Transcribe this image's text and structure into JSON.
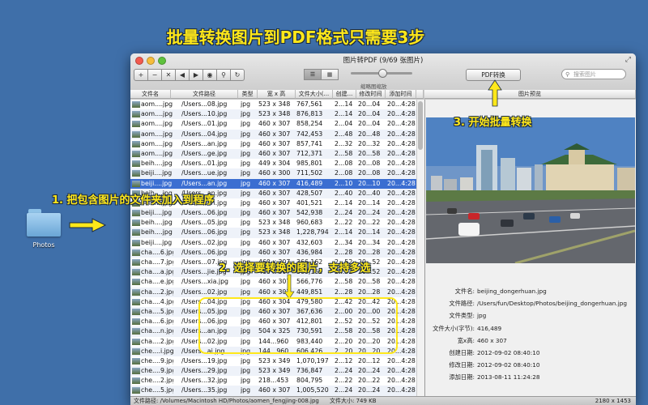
{
  "headline": "批量转换图片到PDF格式只需要3步",
  "desktop": {
    "folder_label": "Photos"
  },
  "callouts": {
    "step1": "1. 把包含图片的文件夹加入到程序",
    "step2": "2. 选择要转换的图片，支持多选",
    "step3": "3. 开始批量转换"
  },
  "window": {
    "title": "图片转PDF (9/69 张图片)",
    "toolbar": {
      "buttons": [
        "+",
        "−",
        "✕",
        "◀",
        "▶",
        "◉",
        "⚲",
        "↻"
      ],
      "view_list": "☰",
      "view_grid": "▦",
      "slider_label": "缩略图缩放",
      "slider_fraction": 0.5,
      "pdf_button": "PDF转换",
      "search_placeholder": "搜索图片"
    },
    "columns": [
      "文件名",
      "文件路径",
      "类型",
      "宽 x 高",
      "文件大小(...",
      "创建...",
      "修改时间",
      "添加时间"
    ],
    "preview_header": "图片预览",
    "rows": [
      {
        "name": "aom....jpg",
        "path": "/Users...08.jpg",
        "type": "jpg",
        "dim": "523 x 348",
        "size": "767,561",
        "c": "2...14",
        "m": "20...04",
        "a": "20...4:28",
        "sel": false
      },
      {
        "name": "aom....jpg",
        "path": "/Users...10.jpg",
        "type": "jpg",
        "dim": "523 x 348",
        "size": "876,813",
        "c": "2...14",
        "m": "20...04",
        "a": "20...4:28",
        "sel": false
      },
      {
        "name": "aom....jpg",
        "path": "/Users...01.jpg",
        "type": "jpg",
        "dim": "460 x 307",
        "size": "858,254",
        "c": "2...04",
        "m": "20...04",
        "a": "20...4:28",
        "sel": false
      },
      {
        "name": "aom....jpg",
        "path": "/Users...04.jpg",
        "type": "jpg",
        "dim": "460 x 307",
        "size": "742,453",
        "c": "2...48",
        "m": "20...48",
        "a": "20...4:28",
        "sel": false
      },
      {
        "name": "aom....jpg",
        "path": "/Users...an.jpg",
        "type": "jpg",
        "dim": "460 x 307",
        "size": "857,741",
        "c": "2...32",
        "m": "20...32",
        "a": "20...4:28",
        "sel": false
      },
      {
        "name": "aom....jpg",
        "path": "/Users...ge.jpg",
        "type": "jpg",
        "dim": "460 x 307",
        "size": "712,371",
        "c": "2...58",
        "m": "20...58",
        "a": "20...4:28",
        "sel": false
      },
      {
        "name": "beih....jpg",
        "path": "/Users...01.jpg",
        "type": "jpg",
        "dim": "449 x 304",
        "size": "985,801",
        "c": "2...08",
        "m": "20...08",
        "a": "20...4:28",
        "sel": false
      },
      {
        "name": "beiji....jpg",
        "path": "/Users...ue.jpg",
        "type": "jpg",
        "dim": "460 x 300",
        "size": "711,502",
        "c": "2...08",
        "m": "20...08",
        "a": "20...4:28",
        "sel": false
      },
      {
        "name": "beiji....jpg",
        "path": "/Users...an.jpg",
        "type": "jpg",
        "dim": "460 x 307",
        "size": "416,489",
        "c": "2...10",
        "m": "20...10",
        "a": "20...4:28",
        "sel": true
      },
      {
        "name": "beih....jpg",
        "path": "/Users...an.jpg",
        "type": "jpg",
        "dim": "460 x 307",
        "size": "428,507",
        "c": "2...40",
        "m": "20...40",
        "a": "20...4:28",
        "sel": false
      },
      {
        "name": "beih....jpg",
        "path": "/Users...an.jpg",
        "type": "jpg",
        "dim": "460 x 307",
        "size": "401,521",
        "c": "2...14",
        "m": "20...14",
        "a": "20...4:28",
        "sel": false
      },
      {
        "name": "beiji....jpg",
        "path": "/Users...06.jpg",
        "type": "jpg",
        "dim": "460 x 307",
        "size": "542,938",
        "c": "2...24",
        "m": "20...24",
        "a": "20...4:28",
        "sel": false
      },
      {
        "name": "beih....jpg",
        "path": "/Users...05.jpg",
        "type": "jpg",
        "dim": "523 x 348",
        "size": "960,683",
        "c": "2...22",
        "m": "20...22",
        "a": "20...4:28",
        "sel": false
      },
      {
        "name": "beih....jpg",
        "path": "/Users...06.jpg",
        "type": "jpg",
        "dim": "523 x 348",
        "size": "1,228,794",
        "c": "2...14",
        "m": "20...14",
        "a": "20...4:28",
        "sel": false
      },
      {
        "name": "beiji....jpg",
        "path": "/Users...02.jpg",
        "type": "jpg",
        "dim": "460 x 307",
        "size": "432,603",
        "c": "2...34",
        "m": "20...34",
        "a": "20...4:28",
        "sel": false
      },
      {
        "name": "cha....6.jpg",
        "path": "/Users...06.jpg",
        "type": "jpg",
        "dim": "460 x 307",
        "size": "436,984",
        "c": "2...28",
        "m": "20...28",
        "a": "20...4:28",
        "sel": false
      },
      {
        "name": "cha....7.jpg",
        "path": "/Users...07.jpg",
        "type": "jpg",
        "dim": "460 x 307",
        "size": "366,162",
        "c": "2...52",
        "m": "20...52",
        "a": "20...4:28",
        "sel": false
      },
      {
        "name": "cha....a.jpg",
        "path": "/Users...jie.jpg",
        "type": "jpg",
        "dim": "460 x 307",
        "size": "366,162",
        "c": "2...52",
        "m": "20...52",
        "a": "20...4:28",
        "sel": false
      },
      {
        "name": "cha....e.jpg",
        "path": "/Users...xia.jpg",
        "type": "jpg",
        "dim": "460 x 307",
        "size": "566,776",
        "c": "2...58",
        "m": "20...58",
        "a": "20...4:28",
        "sel": false
      },
      {
        "name": "cha....2.jpg",
        "path": "/Users...02.jpg",
        "type": "jpg",
        "dim": "460 x 307",
        "size": "449,851",
        "c": "2...28",
        "m": "20...28",
        "a": "20...4:28",
        "sel": false
      },
      {
        "name": "cha....4.jpg",
        "path": "/Users...04.jpg",
        "type": "jpg",
        "dim": "460 x 304",
        "size": "479,580",
        "c": "2...42",
        "m": "20...42",
        "a": "20...4:28",
        "sel": false
      },
      {
        "name": "cha....5.jpg",
        "path": "/Users...05.jpg",
        "type": "jpg",
        "dim": "460 x 307",
        "size": "367,636",
        "c": "2...00",
        "m": "20...00",
        "a": "20...4:28",
        "sel": false
      },
      {
        "name": "cha....6.jpg",
        "path": "/Users...06.jpg",
        "type": "jpg",
        "dim": "460 x 307",
        "size": "412,801",
        "c": "2...52",
        "m": "20...52",
        "a": "20...4:28",
        "sel": false
      },
      {
        "name": "cha....n.jpg",
        "path": "/Users...an.jpg",
        "type": "jpg",
        "dim": "504 x 325",
        "size": "730,591",
        "c": "2...58",
        "m": "20...58",
        "a": "20...4:28",
        "sel": false
      },
      {
        "name": "cha....2.jpg",
        "path": "/Users...02.jpg",
        "type": "jpg",
        "dim": "144...960",
        "size": "983,440",
        "c": "2...20",
        "m": "20...20",
        "a": "20...4:28",
        "sel": false
      },
      {
        "name": "che....i.jpg",
        "path": "/Users...ai.jpg",
        "type": "jpg",
        "dim": "144...960",
        "size": "606,426",
        "c": "2...20",
        "m": "20...20",
        "a": "20...4:28",
        "sel": false
      },
      {
        "name": "che....9.jpg",
        "path": "/Users...19.jpg",
        "type": "jpg",
        "dim": "523 x 349",
        "size": "1,070,197",
        "c": "2...12",
        "m": "20...12",
        "a": "20...4:28",
        "sel": false
      },
      {
        "name": "che....9.jpg",
        "path": "/Users...29.jpg",
        "type": "jpg",
        "dim": "523 x 349",
        "size": "736,847",
        "c": "2...24",
        "m": "20...24",
        "a": "20...4:28",
        "sel": false
      },
      {
        "name": "che....2.jpg",
        "path": "/Users...32.jpg",
        "type": "jpg",
        "dim": "218...453",
        "size": "804,795",
        "c": "2...22",
        "m": "20...22",
        "a": "20...4:28",
        "sel": false
      },
      {
        "name": "che....5.jpg",
        "path": "/Users...35.jpg",
        "type": "jpg",
        "dim": "460 x 307",
        "size": "1,005,520",
        "c": "2...24",
        "m": "20...24",
        "a": "20...4:28",
        "sel": false
      }
    ],
    "info": [
      {
        "k": "文件名:",
        "v": "beijing_dongerhuan.jpg"
      },
      {
        "k": "文件路径:",
        "v": "/Users/fun/Desktop/Photos/beijing_dongerhuan.jpg"
      },
      {
        "k": "文件类型:",
        "v": "jpg"
      },
      {
        "k": "文件大小(字节):",
        "v": "416,489"
      },
      {
        "k": "宽x高:",
        "v": "460 x 307"
      },
      {
        "k": "创建日期:",
        "v": "2012-09-02  08:40:10"
      },
      {
        "k": "修改日期:",
        "v": "2012-09-02  08:40:10"
      },
      {
        "k": "添加日期:",
        "v": "2013-08-11  11:24:28"
      }
    ],
    "status": {
      "path": "文件路径: /Volumes/Macintosh HD/Photos/aomen_fengjing-008.jpg",
      "size": "文件大小: 749 KB",
      "dims": "2180 x 1453"
    }
  }
}
